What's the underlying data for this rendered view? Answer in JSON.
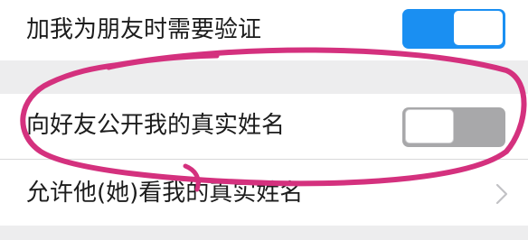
{
  "settings": {
    "items": [
      {
        "label": "加我为朋友时需要验证",
        "control": "toggle",
        "state": "on"
      },
      {
        "label": "向好友公开我的真实姓名",
        "control": "toggle",
        "state": "off"
      },
      {
        "label": "允许他(她)看我的真实姓名",
        "control": "disclosure"
      }
    ]
  },
  "colors": {
    "toggle_on": "#1a8ff2",
    "toggle_off": "#a8a8aa",
    "annotation_ink": "#d4317e",
    "background": "#ededee"
  },
  "icons": {
    "chevron": "chevron-right-icon"
  }
}
